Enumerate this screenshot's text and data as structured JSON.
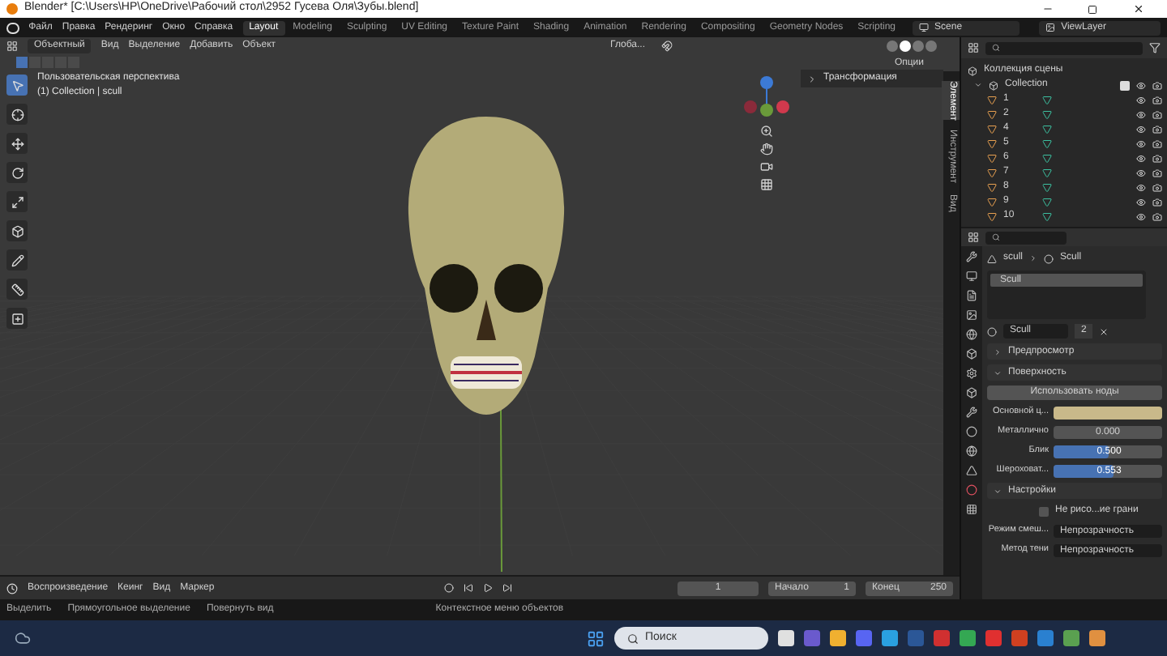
{
  "window": {
    "title": "Blender* [C:\\Users\\HP\\OneDrive\\Рабочий стол\\2952 Гусева Оля\\Зубы.blend]"
  },
  "menu": [
    "Файл",
    "Правка",
    "Рендеринг",
    "Окно",
    "Справка"
  ],
  "workspaces": [
    {
      "label": "Layout",
      "selected": true
    },
    {
      "label": "Modeling",
      "selected": false
    },
    {
      "label": "Sculpting",
      "selected": false
    },
    {
      "label": "UV Editing",
      "selected": false
    },
    {
      "label": "Texture Paint",
      "selected": false
    },
    {
      "label": "Shading",
      "selected": false
    },
    {
      "label": "Animation",
      "selected": false
    },
    {
      "label": "Rendering",
      "selected": false
    },
    {
      "label": "Compositing",
      "selected": false
    },
    {
      "label": "Geometry Nodes",
      "selected": false
    },
    {
      "label": "Scripting",
      "selected": false
    }
  ],
  "scene": "Scene",
  "view_layer": "ViewLayer",
  "viewport": {
    "mode": "Объектный",
    "menu": [
      "Вид",
      "Выделение",
      "Добавить",
      "Объект"
    ],
    "orientation": "Глоба...",
    "options": "Опции",
    "select_modes": [
      {
        "selected": true
      },
      {
        "selected": false
      },
      {
        "selected": false
      },
      {
        "selected": false
      },
      {
        "selected": false
      }
    ],
    "shading": [
      {
        "selected": false
      },
      {
        "selected": true
      },
      {
        "selected": false
      },
      {
        "selected": false
      }
    ],
    "overlay_title": "Пользовательская перспектива",
    "overlay_subtitle": "(1) Collection | scull",
    "tools": [
      {
        "kind": "select",
        "selected": true
      },
      {
        "kind": "cursor",
        "selected": false
      },
      {
        "kind": "move",
        "selected": false
      },
      {
        "kind": "rotate",
        "selected": false
      },
      {
        "kind": "scale",
        "selected": false
      },
      {
        "kind": "transform",
        "selected": false
      },
      {
        "kind": "annotate",
        "selected": false
      },
      {
        "kind": "measure",
        "selected": false
      },
      {
        "kind": "add",
        "selected": false
      }
    ],
    "n_panel": {
      "section": "Трансформация",
      "tabs": [
        {
          "label": "Элемент",
          "selected": true
        },
        {
          "label": "Инструмент",
          "selected": false
        },
        {
          "label": "Вид",
          "selected": false
        }
      ]
    }
  },
  "outliner": {
    "root": "Коллекция сцены",
    "collection": {
      "label": "Collection",
      "checked": true,
      "children": [
        "1",
        "2",
        "4",
        "5",
        "6",
        "7",
        "8",
        "9",
        "10"
      ]
    }
  },
  "properties": {
    "object": "scull",
    "material": "Scull",
    "slots": [
      "Scull"
    ],
    "material_field": "Scull",
    "users": "2",
    "panels": [
      {
        "title": "Предпросмотр",
        "expanded": false
      },
      {
        "title": "Поверхность",
        "expanded": true
      }
    ],
    "use_nodes": "Использовать ноды",
    "fields": [
      {
        "kind": "color",
        "label": "Основной ц...",
        "color": "#c9b98a"
      },
      {
        "kind": "number",
        "label": "Металлично",
        "value": "0.000"
      },
      {
        "kind": "slider",
        "label": "Блик",
        "value": "0.500",
        "level": 0.5
      },
      {
        "kind": "slider",
        "label": "Шероховат...",
        "value": "0.553",
        "level": 0.553
      }
    ],
    "settings": {
      "title": "Настройки",
      "expanded": true,
      "backface": {
        "label": "Не рисо...ие грани",
        "checked": false
      },
      "dropdowns": [
        {
          "label": "Режим смеш...",
          "value": "Непрозрачность"
        },
        {
          "label": "Метод тени",
          "value": "Непрозрачность"
        }
      ]
    }
  },
  "timeline": {
    "menu": [
      "Воспроизведение",
      "Кеинг",
      "Вид",
      "Маркер"
    ],
    "current": "1",
    "start_label": "Начало",
    "start": "1",
    "end_label": "Конец",
    "end": "250"
  },
  "status_bar": [
    "Выделить",
    "Прямоугольное выделение",
    "Повернуть вид",
    "Контекстное меню объектов"
  ],
  "taskbar": {
    "search": "Поиск"
  }
}
